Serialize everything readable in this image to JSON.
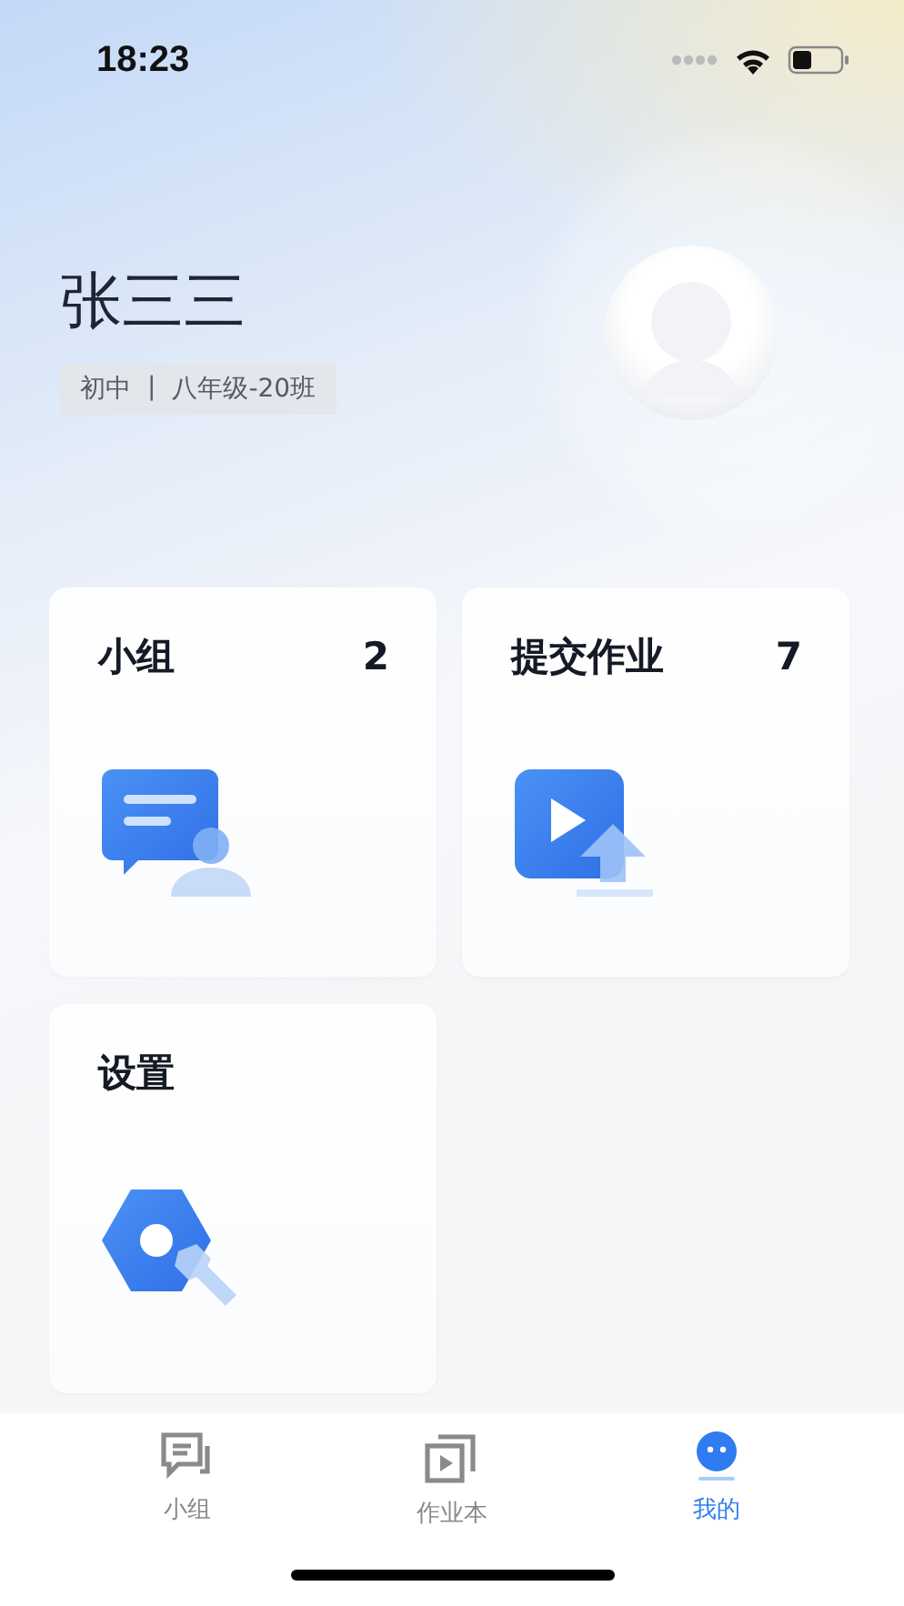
{
  "status_bar": {
    "time": "18:23"
  },
  "profile": {
    "name": "张三三",
    "school_level": "初中",
    "separator": "|",
    "class": "八年级-20班"
  },
  "cards": [
    {
      "kind": "group",
      "title": "小组",
      "count": "2"
    },
    {
      "kind": "upload",
      "title": "提交作业",
      "count": "7"
    },
    {
      "kind": "settings",
      "title": "设置"
    }
  ],
  "tab_bar": [
    {
      "kind": "group",
      "label": "小组",
      "selected": false
    },
    {
      "kind": "homework",
      "label": "作业本",
      "selected": false
    },
    {
      "kind": "me",
      "label": "我的",
      "selected": true
    }
  ]
}
